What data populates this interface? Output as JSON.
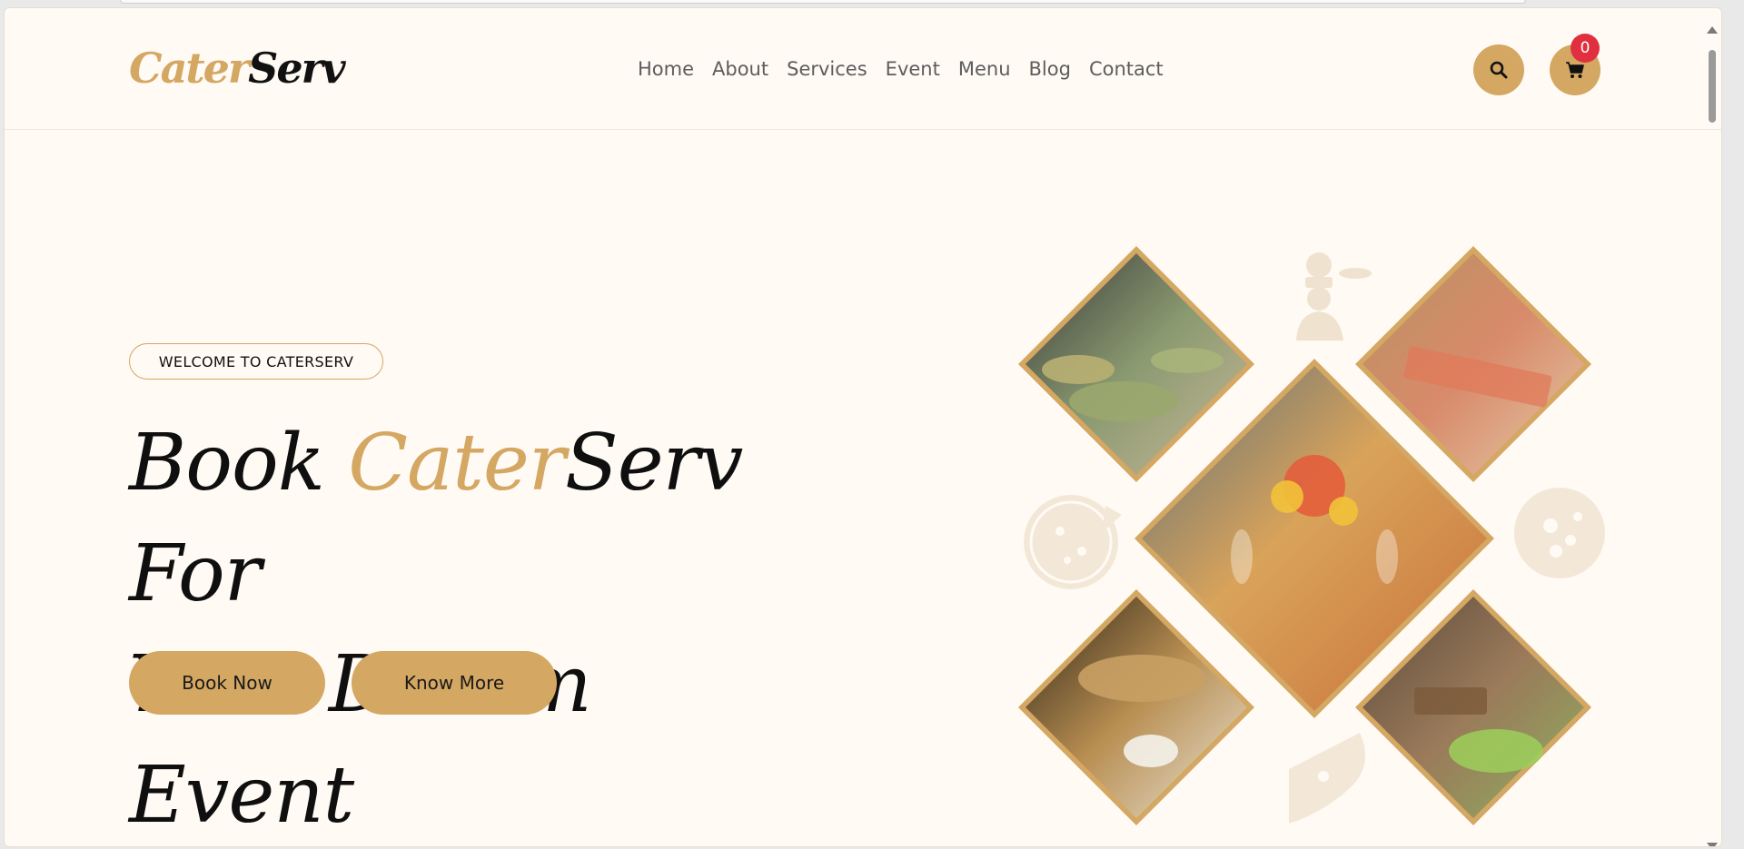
{
  "brand": {
    "part1": "Cater",
    "part2": "Serv"
  },
  "nav": {
    "items": [
      {
        "label": "Home"
      },
      {
        "label": "About"
      },
      {
        "label": "Services"
      },
      {
        "label": "Event"
      },
      {
        "label": "Menu"
      },
      {
        "label": "Blog"
      },
      {
        "label": "Contact"
      }
    ]
  },
  "header": {
    "cart_count": "0"
  },
  "hero": {
    "tagline": "WELCOME TO CATERSERV",
    "title_part1": "Book ",
    "title_highlight": "Cater",
    "title_part2": "Serv For",
    "title_line2": "Your Dream Event",
    "book_button": "Book Now",
    "more_button": "Know More"
  },
  "icons": {
    "search": "search-icon",
    "cart": "cart-icon",
    "chef": "chef-icon",
    "pizza": "pizza-icon"
  },
  "colors": {
    "accent": "#d4a762",
    "background": "#fffaf4",
    "badge": "#e0303f",
    "text": "#111111"
  }
}
